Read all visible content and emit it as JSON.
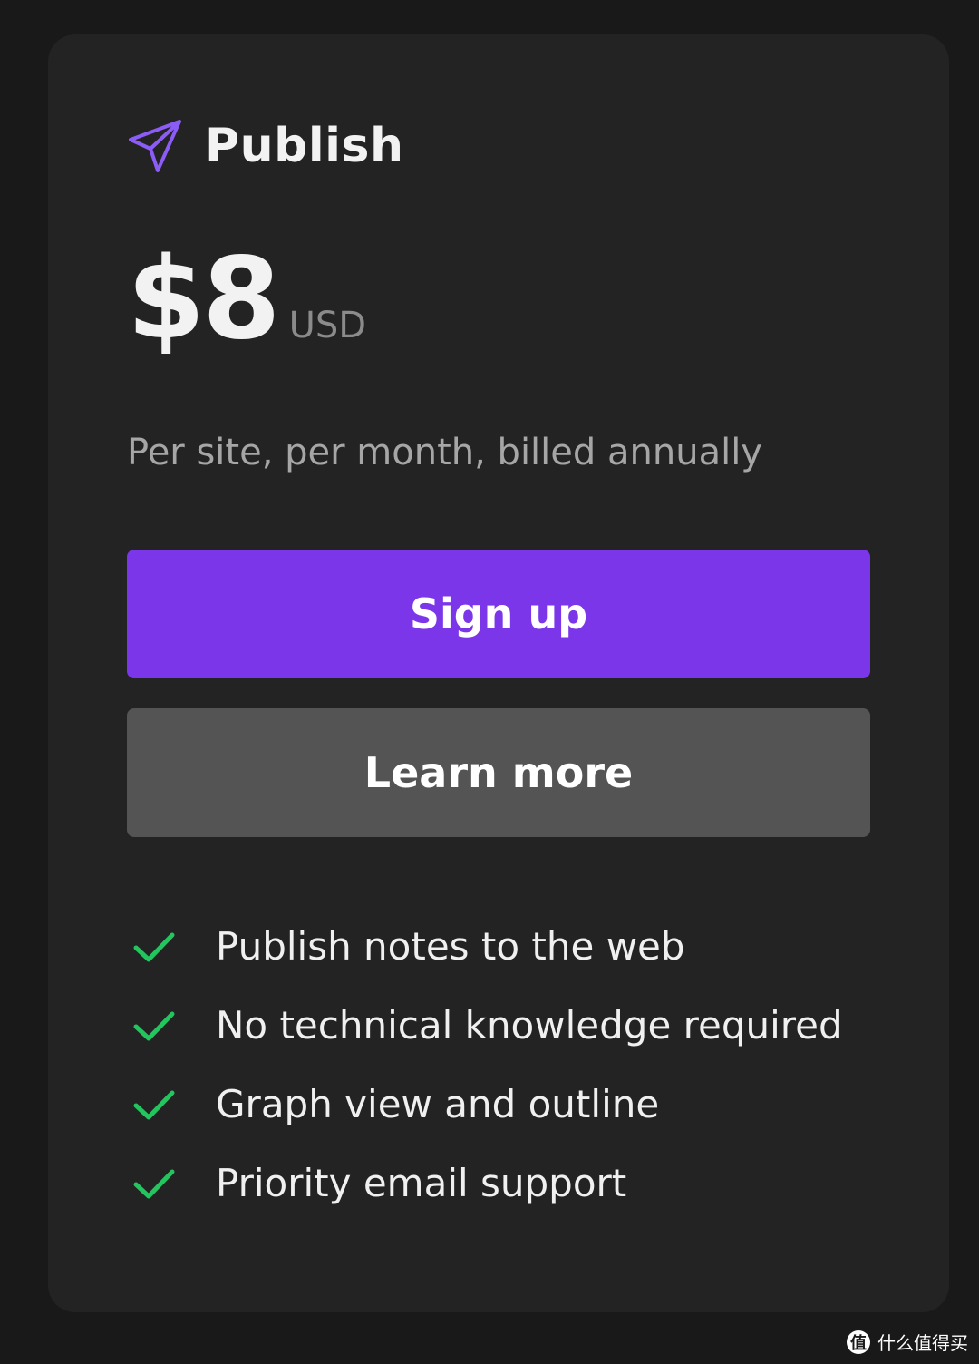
{
  "plan": {
    "name": "Publish",
    "icon": "paper-plane-icon",
    "icon_color": "#8b5cf6"
  },
  "pricing": {
    "price": "$8",
    "currency": "USD",
    "billing_note": "Per site, per month, billed annually"
  },
  "actions": {
    "primary_label": "Sign up",
    "primary_color": "#7a36e8",
    "secondary_label": "Learn more",
    "secondary_color": "#545454"
  },
  "features": {
    "check_icon": "checkmark-icon",
    "check_color": "#22c55e",
    "items": [
      "Publish notes to the web",
      "No technical knowledge required",
      "Graph view and outline",
      "Priority email support"
    ]
  },
  "watermark": {
    "logo_glyph": "值",
    "text": "什么值得买"
  }
}
